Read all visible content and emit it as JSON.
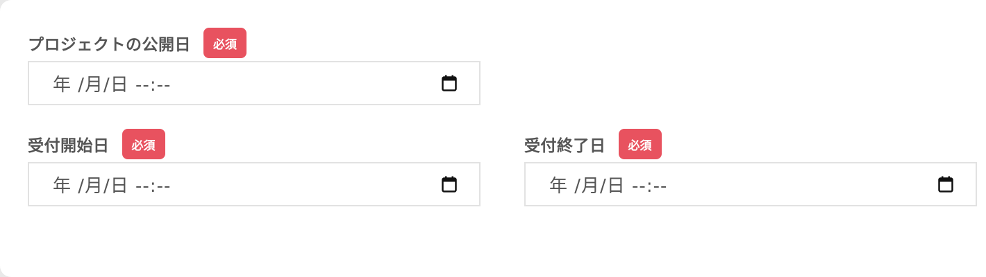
{
  "fields": [
    {
      "label": "プロジェクトの公開日",
      "badge": "必須",
      "value": "年 /月/日  --:--",
      "icon": "calendar-icon"
    },
    {
      "label": "受付開始日",
      "badge": "必須",
      "value": "年 /月/日  --:--",
      "icon": "calendar-icon"
    },
    {
      "label": "受付終了日",
      "badge": "必須",
      "value": "年 /月/日  --:--",
      "icon": "calendar-icon"
    }
  ],
  "colors": {
    "badge": "#e8525f",
    "label": "#555555",
    "input_border": "#e2e2e2"
  }
}
